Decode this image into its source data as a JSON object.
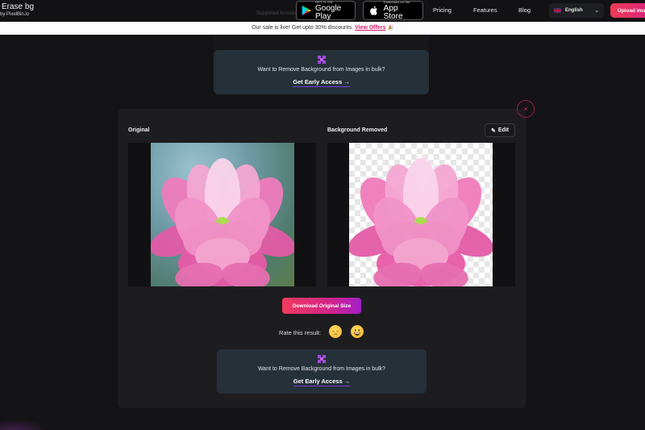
{
  "navbar": {
    "logo_title": "Erase bg",
    "logo_subtitle": "by PixelBin.io",
    "supported_formats_label": "Supported formats",
    "google_play": {
      "small": "GET IT ON",
      "big": "Google Play",
      "icon": "google-play-icon"
    },
    "app_store": {
      "small": "Download on the",
      "big": "App Store",
      "icon": "apple-icon"
    },
    "links": [
      "Pricing",
      "Features",
      "Blog"
    ],
    "language": {
      "flag": "uk-flag-icon",
      "selected": "English"
    },
    "upload_button": "Upload Image"
  },
  "sale_banner": {
    "text": "Our sale is live! Get upto 30% discounts.",
    "link": "View Offers",
    "emoji": "🎉"
  },
  "bulk_promo": {
    "icon": "bulk-grid-icon",
    "text": "Want to Remove Background from Images in bulk?",
    "link": "Get Early Access",
    "arrow": "→"
  },
  "result_modal": {
    "close_icon": "×",
    "original_label": "Original",
    "removed_label": "Background Removed",
    "edit_button": "Edit",
    "edit_icon": "✎",
    "download_button": "Download Original Size",
    "rate_label": "Rate this result:",
    "ratings": [
      "sad-face",
      "happy-face"
    ]
  },
  "colors": {
    "accent_pink": "#d81b6a",
    "gradient_start": "#f23a5c",
    "gradient_end": "#a21ec8",
    "promo_bg": "#253039"
  }
}
